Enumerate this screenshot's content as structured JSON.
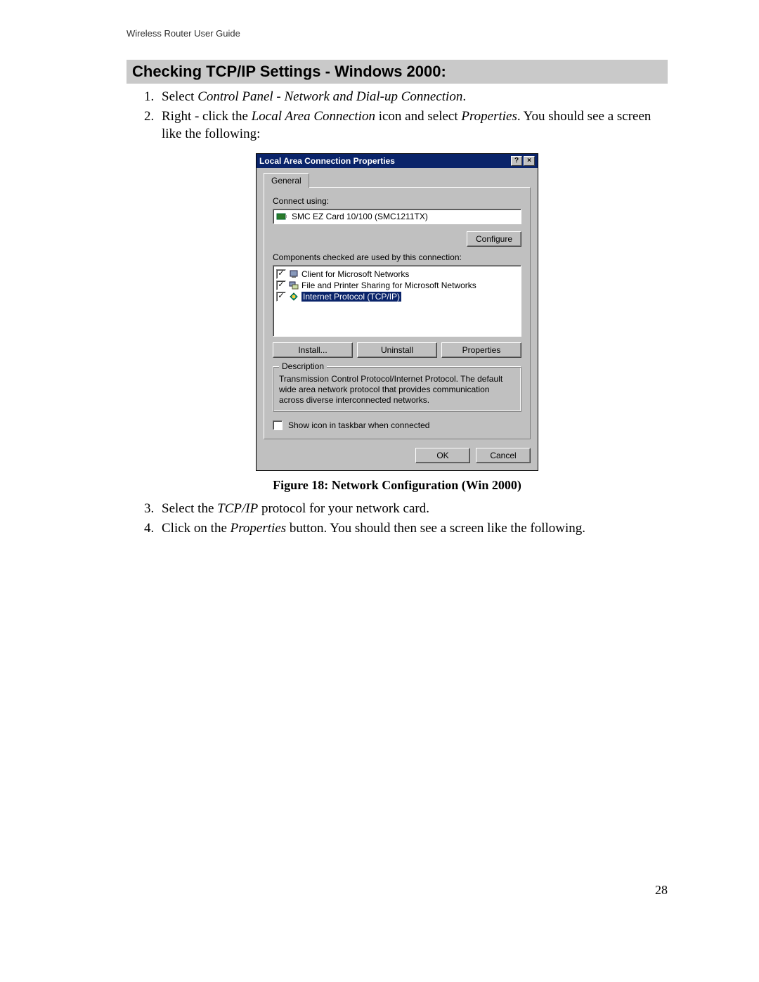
{
  "header": {
    "guide_name": "Wireless Router User Guide"
  },
  "section": {
    "heading": "Checking TCP/IP Settings - Windows 2000:"
  },
  "steps": {
    "s1_a": "Select ",
    "s1_b": "Control Panel - Network and Dial-up Connection",
    "s1_c": ".",
    "s2_a": "Right - click the ",
    "s2_b": "Local Area Connection",
    "s2_c": " icon and select ",
    "s2_d": "Properties",
    "s2_e": ". You should see a screen like the following:",
    "s3_a": "Select the ",
    "s3_b": "TCP/IP",
    "s3_c": " protocol for your network card.",
    "s4_a": "Click on the ",
    "s4_b": "Properties",
    "s4_c": " button. You should then see a screen like the following."
  },
  "dialog": {
    "title": "Local Area Connection Properties",
    "help_btn": "?",
    "close_btn": "×",
    "tab_general": "General",
    "connect_using_label": "Connect using:",
    "adapter": "SMC EZ Card 10/100 (SMC1211TX)",
    "configure_btn": "Configure",
    "components_label": "Components checked are used by this connection:",
    "items": [
      {
        "checked": true,
        "text": "Client for Microsoft Networks",
        "selected": false
      },
      {
        "checked": true,
        "text": "File and Printer Sharing for Microsoft Networks",
        "selected": false
      },
      {
        "checked": true,
        "text": "Internet Protocol (TCP/IP)",
        "selected": true
      }
    ],
    "install_btn": "Install...",
    "uninstall_btn": "Uninstall",
    "properties_btn": "Properties",
    "group_title": "Description",
    "description": "Transmission Control Protocol/Internet Protocol. The default wide area network protocol that provides communication across diverse interconnected networks.",
    "taskbar_checkbox": "Show icon in taskbar when connected",
    "ok_btn": "OK",
    "cancel_btn": "Cancel"
  },
  "caption": "Figure 18: Network Configuration (Win 2000)",
  "page_number": "28"
}
